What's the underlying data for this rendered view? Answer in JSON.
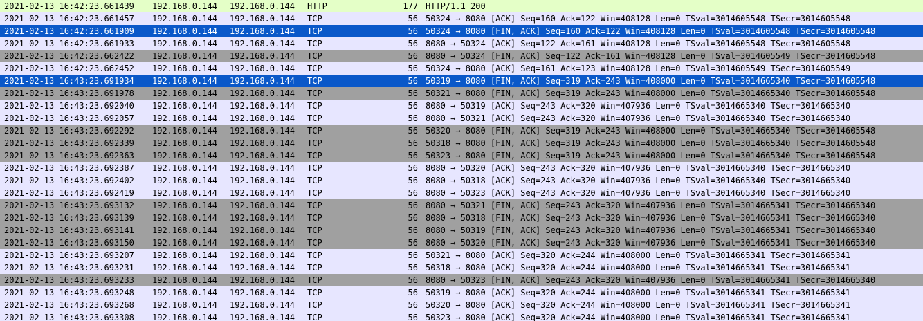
{
  "colors": {
    "http": "#e4ffc7",
    "tcp": "#e7e6ff",
    "fin": "#a0a0a0",
    "selected": "#0a58c9",
    "selected_text": "#ffffff"
  },
  "packets": [
    {
      "time": "2021-02-13 16:42:23.661439",
      "src": "192.168.0.144",
      "dst": "192.168.0.144",
      "proto": "HTTP",
      "len": "177",
      "info": "HTTP/1.1 200",
      "style": "http"
    },
    {
      "time": "2021-02-13 16:42:23.661457",
      "src": "192.168.0.144",
      "dst": "192.168.0.144",
      "proto": "TCP",
      "len": "56",
      "info": "50324 → 8080 [ACK] Seq=160 Ack=122 Win=408128 Len=0 TSval=3014605548 TSecr=3014605548",
      "style": "tcp"
    },
    {
      "time": "2021-02-13 16:42:23.661909",
      "src": "192.168.0.144",
      "dst": "192.168.0.144",
      "proto": "TCP",
      "len": "56",
      "info": "50324 → 8080 [FIN, ACK] Seq=160 Ack=122 Win=408128 Len=0 TSval=3014605548 TSecr=3014605548",
      "style": "selected"
    },
    {
      "time": "2021-02-13 16:42:23.661933",
      "src": "192.168.0.144",
      "dst": "192.168.0.144",
      "proto": "TCP",
      "len": "56",
      "info": "8080 → 50324 [ACK] Seq=122 Ack=161 Win=408128 Len=0 TSval=3014605548 TSecr=3014605548",
      "style": "tcp"
    },
    {
      "time": "2021-02-13 16:42:23.662422",
      "src": "192.168.0.144",
      "dst": "192.168.0.144",
      "proto": "TCP",
      "len": "56",
      "info": "8080 → 50324 [FIN, ACK] Seq=122 Ack=161 Win=408128 Len=0 TSval=3014605549 TSecr=3014605548",
      "style": "fin"
    },
    {
      "time": "2021-02-13 16:42:23.662452",
      "src": "192.168.0.144",
      "dst": "192.168.0.144",
      "proto": "TCP",
      "len": "56",
      "info": "50324 → 8080 [ACK] Seq=161 Ack=123 Win=408128 Len=0 TSval=3014605549 TSecr=3014605549",
      "style": "tcp"
    },
    {
      "time": "2021-02-13 16:43:23.691934",
      "src": "192.168.0.144",
      "dst": "192.168.0.144",
      "proto": "TCP",
      "len": "56",
      "info": "50319 → 8080 [FIN, ACK] Seq=319 Ack=243 Win=408000 Len=0 TSval=3014665340 TSecr=3014605548",
      "style": "selected"
    },
    {
      "time": "2021-02-13 16:43:23.691978",
      "src": "192.168.0.144",
      "dst": "192.168.0.144",
      "proto": "TCP",
      "len": "56",
      "info": "50321 → 8080 [FIN, ACK] Seq=319 Ack=243 Win=408000 Len=0 TSval=3014665340 TSecr=3014605548",
      "style": "fin"
    },
    {
      "time": "2021-02-13 16:43:23.692040",
      "src": "192.168.0.144",
      "dst": "192.168.0.144",
      "proto": "TCP",
      "len": "56",
      "info": "8080 → 50319 [ACK] Seq=243 Ack=320 Win=407936 Len=0 TSval=3014665340 TSecr=3014665340",
      "style": "tcp"
    },
    {
      "time": "2021-02-13 16:43:23.692057",
      "src": "192.168.0.144",
      "dst": "192.168.0.144",
      "proto": "TCP",
      "len": "56",
      "info": "8080 → 50321 [ACK] Seq=243 Ack=320 Win=407936 Len=0 TSval=3014665340 TSecr=3014665340",
      "style": "tcp"
    },
    {
      "time": "2021-02-13 16:43:23.692292",
      "src": "192.168.0.144",
      "dst": "192.168.0.144",
      "proto": "TCP",
      "len": "56",
      "info": "50320 → 8080 [FIN, ACK] Seq=319 Ack=243 Win=408000 Len=0 TSval=3014665340 TSecr=3014605548",
      "style": "fin"
    },
    {
      "time": "2021-02-13 16:43:23.692339",
      "src": "192.168.0.144",
      "dst": "192.168.0.144",
      "proto": "TCP",
      "len": "56",
      "info": "50318 → 8080 [FIN, ACK] Seq=319 Ack=243 Win=408000 Len=0 TSval=3014665340 TSecr=3014605548",
      "style": "fin"
    },
    {
      "time": "2021-02-13 16:43:23.692363",
      "src": "192.168.0.144",
      "dst": "192.168.0.144",
      "proto": "TCP",
      "len": "56",
      "info": "50323 → 8080 [FIN, ACK] Seq=319 Ack=243 Win=408000 Len=0 TSval=3014665340 TSecr=3014605548",
      "style": "fin"
    },
    {
      "time": "2021-02-13 16:43:23.692387",
      "src": "192.168.0.144",
      "dst": "192.168.0.144",
      "proto": "TCP",
      "len": "56",
      "info": "8080 → 50320 [ACK] Seq=243 Ack=320 Win=407936 Len=0 TSval=3014665340 TSecr=3014665340",
      "style": "tcp"
    },
    {
      "time": "2021-02-13 16:43:23.692402",
      "src": "192.168.0.144",
      "dst": "192.168.0.144",
      "proto": "TCP",
      "len": "56",
      "info": "8080 → 50318 [ACK] Seq=243 Ack=320 Win=407936 Len=0 TSval=3014665340 TSecr=3014665340",
      "style": "tcp"
    },
    {
      "time": "2021-02-13 16:43:23.692419",
      "src": "192.168.0.144",
      "dst": "192.168.0.144",
      "proto": "TCP",
      "len": "56",
      "info": "8080 → 50323 [ACK] Seq=243 Ack=320 Win=407936 Len=0 TSval=3014665340 TSecr=3014665340",
      "style": "tcp"
    },
    {
      "time": "2021-02-13 16:43:23.693132",
      "src": "192.168.0.144",
      "dst": "192.168.0.144",
      "proto": "TCP",
      "len": "56",
      "info": "8080 → 50321 [FIN, ACK] Seq=243 Ack=320 Win=407936 Len=0 TSval=3014665341 TSecr=3014665340",
      "style": "fin"
    },
    {
      "time": "2021-02-13 16:43:23.693139",
      "src": "192.168.0.144",
      "dst": "192.168.0.144",
      "proto": "TCP",
      "len": "56",
      "info": "8080 → 50318 [FIN, ACK] Seq=243 Ack=320 Win=407936 Len=0 TSval=3014665341 TSecr=3014665340",
      "style": "fin"
    },
    {
      "time": "2021-02-13 16:43:23.693141",
      "src": "192.168.0.144",
      "dst": "192.168.0.144",
      "proto": "TCP",
      "len": "56",
      "info": "8080 → 50319 [FIN, ACK] Seq=243 Ack=320 Win=407936 Len=0 TSval=3014665341 TSecr=3014665340",
      "style": "fin"
    },
    {
      "time": "2021-02-13 16:43:23.693150",
      "src": "192.168.0.144",
      "dst": "192.168.0.144",
      "proto": "TCP",
      "len": "56",
      "info": "8080 → 50320 [FIN, ACK] Seq=243 Ack=320 Win=407936 Len=0 TSval=3014665341 TSecr=3014665340",
      "style": "fin"
    },
    {
      "time": "2021-02-13 16:43:23.693207",
      "src": "192.168.0.144",
      "dst": "192.168.0.144",
      "proto": "TCP",
      "len": "56",
      "info": "50321 → 8080 [ACK] Seq=320 Ack=244 Win=408000 Len=0 TSval=3014665341 TSecr=3014665341",
      "style": "tcp"
    },
    {
      "time": "2021-02-13 16:43:23.693231",
      "src": "192.168.0.144",
      "dst": "192.168.0.144",
      "proto": "TCP",
      "len": "56",
      "info": "50318 → 8080 [ACK] Seq=320 Ack=244 Win=408000 Len=0 TSval=3014665341 TSecr=3014665341",
      "style": "tcp"
    },
    {
      "time": "2021-02-13 16:43:23.693233",
      "src": "192.168.0.144",
      "dst": "192.168.0.144",
      "proto": "TCP",
      "len": "56",
      "info": "8080 → 50323 [FIN, ACK] Seq=243 Ack=320 Win=407936 Len=0 TSval=3014665341 TSecr=3014665340",
      "style": "fin"
    },
    {
      "time": "2021-02-13 16:43:23.693248",
      "src": "192.168.0.144",
      "dst": "192.168.0.144",
      "proto": "TCP",
      "len": "56",
      "info": "50319 → 8080 [ACK] Seq=320 Ack=244 Win=408000 Len=0 TSval=3014665341 TSecr=3014665341",
      "style": "tcp"
    },
    {
      "time": "2021-02-13 16:43:23.693268",
      "src": "192.168.0.144",
      "dst": "192.168.0.144",
      "proto": "TCP",
      "len": "56",
      "info": "50320 → 8080 [ACK] Seq=320 Ack=244 Win=408000 Len=0 TSval=3014665341 TSecr=3014665341",
      "style": "tcp"
    },
    {
      "time": "2021-02-13 16:43:23.693308",
      "src": "192.168.0.144",
      "dst": "192.168.0.144",
      "proto": "TCP",
      "len": "56",
      "info": "50323 → 8080 [ACK] Seq=320 Ack=244 Win=408000 Len=0 TSval=3014665341 TSecr=3014665341",
      "style": "tcp"
    }
  ]
}
